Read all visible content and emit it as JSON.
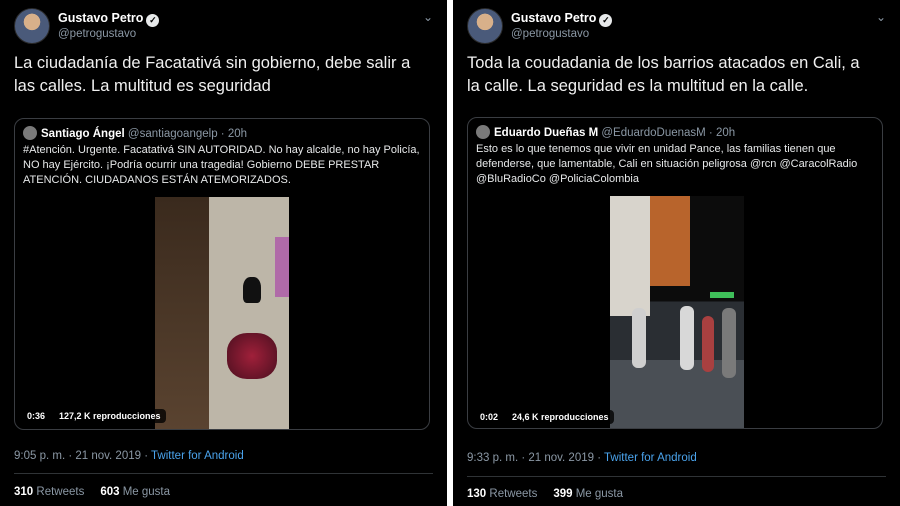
{
  "tweets": [
    {
      "author": {
        "name": "Gustavo Petro",
        "handle": "@petrogustavo",
        "verified_glyph": "✓"
      },
      "text": "La ciudadanía de Facatativá sin gobierno, debe salir a las calles. La multitud es seguridad",
      "quoted": {
        "name": "Santiago Ángel",
        "handle": "@santiagoangelp",
        "time": "20h",
        "text": "#Atención. Urgente. Facatativá SIN AUTORIDAD. No hay alcalde, no hay Policía, NO hay Ejército. ¡Podría ocurrir una tragedia! Gobierno DEBE PRESTAR ATENCIÓN. CIUDADANOS ESTÁN ATEMORIZADOS.",
        "video": {
          "duration": "0:36",
          "views": "127,2 K reproducciones"
        }
      },
      "timestamp": "9:05 p. m. · 21 nov. 2019 · ",
      "source": "Twitter for Android",
      "retweets": "310",
      "retweets_label": "Retweets",
      "likes": "603",
      "likes_label": "Me gusta"
    },
    {
      "author": {
        "name": "Gustavo Petro",
        "handle": "@petrogustavo",
        "verified_glyph": "✓"
      },
      "text": "Toda la coudadania de los barrios atacados en Cali, a la calle. La seguridad es la multitud en la calle.",
      "quoted": {
        "name": "Eduardo Dueñas M",
        "handle": "@EduardoDuenasM",
        "time": "20h",
        "text": "Esto es lo que tenemos que vivir en unidad Pance, las familias tienen que defenderse, que lamentable, Cali  en situación peligrosa @rcn @CaracolRadio @BluRadioCo @PoliciaColombia",
        "video": {
          "duration": "0:02",
          "views": "24,6 K reproducciones"
        }
      },
      "timestamp": "9:33 p. m. · 21 nov. 2019 · ",
      "source": "Twitter for Android",
      "retweets": "130",
      "retweets_label": "Retweets",
      "likes": "399",
      "likes_label": "Me gusta"
    }
  ],
  "colors": {
    "background": "#000000",
    "link": "#4aa3ec",
    "secondary": "#8b98a5",
    "border": "#3a3d42"
  }
}
